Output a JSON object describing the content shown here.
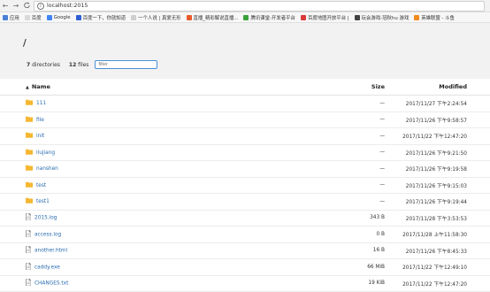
{
  "browser": {
    "back": "←",
    "forward": "→",
    "reload": "C",
    "url": "localhost:2015"
  },
  "bookmarks": [
    {
      "label": "应用",
      "color": "#4a7fd6"
    },
    {
      "label": "百度",
      "color": "#d9d9d9"
    },
    {
      "label": "Google",
      "color": "#4285f4"
    },
    {
      "label": "百度一下，你就知道",
      "color": "#2f5fd3"
    },
    {
      "label": "一个人说 | 真爱无形",
      "color": "#cfcfcf"
    },
    {
      "label": "直播_精彩解说直播...",
      "color": "#e85a2b"
    },
    {
      "label": "腾讯课堂-开发者平台",
      "color": "#3aa13a"
    },
    {
      "label": "百度地图开放平台 |",
      "color": "#d93a3a"
    },
    {
      "label": "玩会游戏-冠秋hu 游戏",
      "color": "#444"
    },
    {
      "label": "英雄联盟 - 斗鱼",
      "color": "#f08b1d"
    }
  ],
  "listing": {
    "path": "/",
    "dir_count": "7",
    "dir_label": "directories",
    "file_count": "12",
    "file_label": "files",
    "filter_placeholder": "filter",
    "col_name": "Name",
    "col_size": "Size",
    "col_modified": "Modified"
  },
  "rows": [
    {
      "name": "111",
      "type": "folder",
      "size": "—",
      "modified": "2017/11/27 下午2:24:54"
    },
    {
      "name": "file",
      "type": "folder",
      "size": "—",
      "modified": "2017/11/26 下午9:58:57"
    },
    {
      "name": "init",
      "type": "folder",
      "size": "—",
      "modified": "2017/11/22 下午12:47:20"
    },
    {
      "name": "liujiang",
      "type": "folder",
      "size": "—",
      "modified": "2017/11/26 下午9:21:50"
    },
    {
      "name": "nanshen",
      "type": "folder",
      "size": "—",
      "modified": "2017/11/26 下午9:19:58"
    },
    {
      "name": "test",
      "type": "folder",
      "size": "—",
      "modified": "2017/11/26 下午9:15:03"
    },
    {
      "name": "test1",
      "type": "folder",
      "size": "—",
      "modified": "2017/11/26 下午9:19:44"
    },
    {
      "name": "2015.log",
      "type": "file",
      "size": "343 B",
      "modified": "2017/11/28 下午3:53:53"
    },
    {
      "name": "access.log",
      "type": "file",
      "size": "0 B",
      "modified": "2017/11/28 上午11:58:30"
    },
    {
      "name": "another.html",
      "type": "file",
      "size": "16 B",
      "modified": "2017/11/26 下午8:45:33"
    },
    {
      "name": "caddy.exe",
      "type": "file",
      "size": "66 MiB",
      "modified": "2017/11/22 下午12:49:10"
    },
    {
      "name": "CHANGES.txt",
      "type": "file",
      "size": "19 KiB",
      "modified": "2017/11/22 下午12:47:20"
    }
  ],
  "colors": {
    "folder": "#f5b731",
    "link": "#2a6db0",
    "filter_border": "#4a90d9"
  }
}
